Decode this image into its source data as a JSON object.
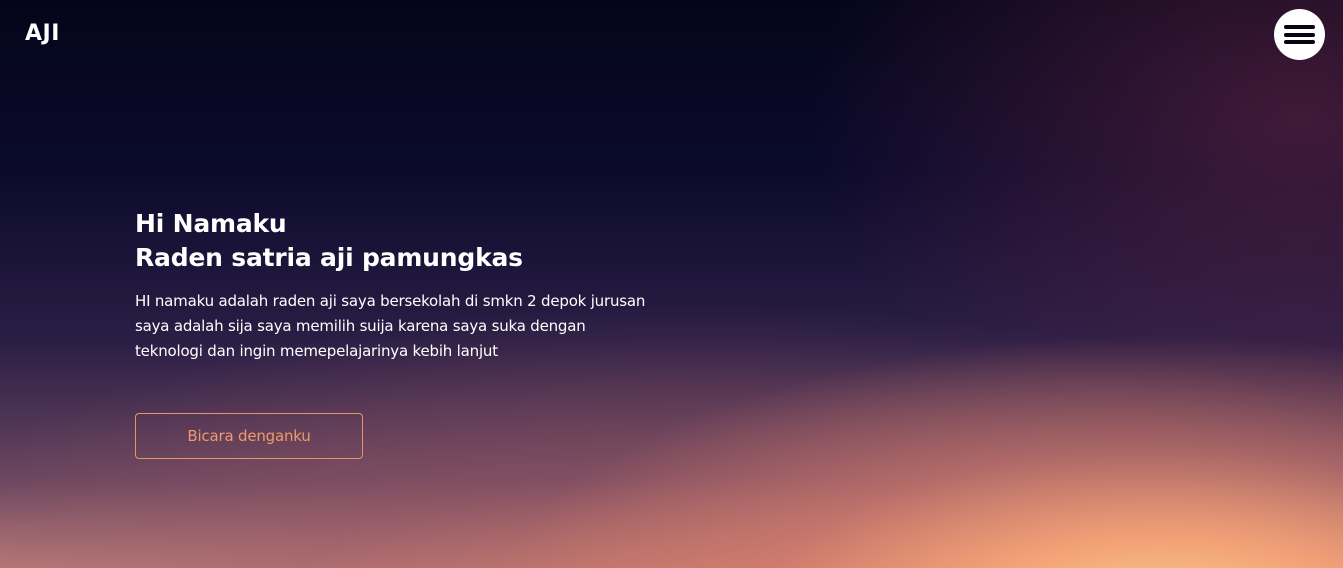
{
  "header": {
    "logo": "AJI",
    "menu_icon": "hamburger-menu-icon"
  },
  "hero": {
    "title_line1": "Hi Namaku",
    "title_line2": "Raden satria aji pamungkas",
    "description": "HI namaku adalah raden aji saya bersekolah di smkn 2 depok jurusan saya adalah sija saya memilih suija karena saya suka dengan teknologi dan ingin memepelajarinya kebih lanjut",
    "cta_label": "Bicara denganku"
  },
  "colors": {
    "accent": "#ef9a6a",
    "background_top": "#04051a",
    "background_glow": "#ffd68c"
  }
}
